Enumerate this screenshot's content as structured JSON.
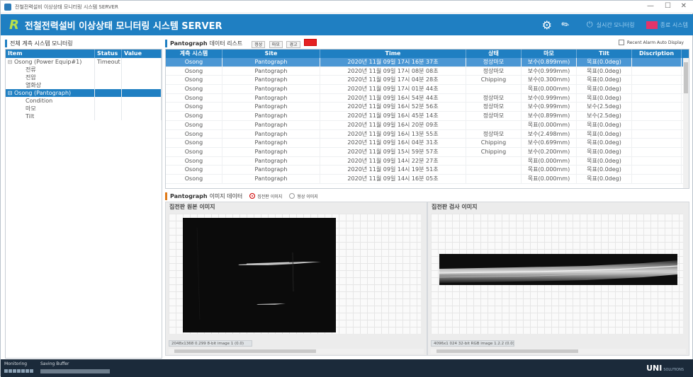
{
  "window": {
    "title": "전철전력설비 이상상태 모니터링 시스템 SERVER",
    "min": "—",
    "max": "☐",
    "close": "✕"
  },
  "header": {
    "title": "전철전력설비 이상상태 모니터링 시스템 SERVER",
    "realtime_label": "실시간 모니터링",
    "exit_label": "종료 시스템",
    "accent": "#1f7fc2"
  },
  "left": {
    "section_title": "전체 계측 시스템 모니터링",
    "columns": [
      "Item",
      "Status",
      "Value"
    ],
    "rows": [
      {
        "label": "Osong (Power Equip#1)",
        "status": "Timeout",
        "level": 0,
        "expander": "⊟",
        "selected": false
      },
      {
        "label": "전류",
        "status": "",
        "level": 1,
        "selected": false
      },
      {
        "label": "전압",
        "status": "",
        "level": 1,
        "selected": false
      },
      {
        "label": "열화상",
        "status": "",
        "level": 1,
        "selected": false
      },
      {
        "label": "Osong (Pantograph)",
        "status": "",
        "level": 0,
        "expander": "⊟",
        "selected": true
      },
      {
        "label": "Condition",
        "status": "",
        "level": 1,
        "selected": false
      },
      {
        "label": "마모",
        "status": "",
        "level": 1,
        "selected": false
      },
      {
        "label": "Tilt",
        "status": "",
        "level": 1,
        "selected": false
      }
    ]
  },
  "data_list": {
    "title_en": "Pantograph",
    "title_ko": "데이터 리스트",
    "filters": [
      "정상",
      "마모",
      "경고",
      ""
    ],
    "checkbox_label": "Recent Alarm Auto Display",
    "columns": [
      "계측 시스템",
      "Site",
      "Time",
      "상태",
      "마모",
      "Tilt",
      "Discription"
    ],
    "rows": [
      [
        "Osong",
        "Pantograph",
        "2020년 11월 09일 17시 16분 37초",
        "정상마모",
        "보수(0.899mm)",
        "목표(0.0deg)",
        ""
      ],
      [
        "Osong",
        "Pantograph",
        "2020년 11월 09일 17시 08분 08초",
        "정상마모",
        "보수(0.999mm)",
        "목표(0.0deg)",
        ""
      ],
      [
        "Osong",
        "Pantograph",
        "2020년 11월 09일 17시 04분 28초",
        "Chipping",
        "보수(0.300mm)",
        "목표(0.0deg)",
        ""
      ],
      [
        "Osong",
        "Pantograph",
        "2020년 11월 09일 17시 01분 44초",
        "",
        "목표(0.000mm)",
        "목표(0.0deg)",
        ""
      ],
      [
        "Osong",
        "Pantograph",
        "2020년 11월 09일 16시 54분 44초",
        "정상마모",
        "보수(0.999mm)",
        "목표(0.0deg)",
        ""
      ],
      [
        "Osong",
        "Pantograph",
        "2020년 11월 09일 16시 52분 56초",
        "정상마모",
        "보수(0.999mm)",
        "보수(2.5deg)",
        ""
      ],
      [
        "Osong",
        "Pantograph",
        "2020년 11월 09일 16시 45분 14초",
        "정상마모",
        "보수(0.899mm)",
        "보수(2.5deg)",
        ""
      ],
      [
        "Osong",
        "Pantograph",
        "2020년 11월 09일 16시 20분 09초",
        "",
        "목표(0.000mm)",
        "목표(0.0deg)",
        ""
      ],
      [
        "Osong",
        "Pantograph",
        "2020년 11월 09일 16시 13분 55초",
        "정상마모",
        "보수(2.498mm)",
        "목표(0.0deg)",
        ""
      ],
      [
        "Osong",
        "Pantograph",
        "2020년 11월 09일 16시 04분 31초",
        "Chipping",
        "보수(0.699mm)",
        "목표(0.0deg)",
        ""
      ],
      [
        "Osong",
        "Pantograph",
        "2020년 11월 09일 15시 59분 57초",
        "Chipping",
        "보수(0.200mm)",
        "목표(0.0deg)",
        ""
      ],
      [
        "Osong",
        "Pantograph",
        "2020년 11월 09일 14시 22분 27초",
        "",
        "목표(0.000mm)",
        "목표(0.0deg)",
        ""
      ],
      [
        "Osong",
        "Pantograph",
        "2020년 11월 09일 14시 19분 51초",
        "",
        "목표(0.000mm)",
        "목표(0.0deg)",
        ""
      ],
      [
        "Osong",
        "Pantograph",
        "2020년 11월 09일 14시 16분 05초",
        "",
        "목표(0.000mm)",
        "목표(0.0deg)",
        ""
      ]
    ]
  },
  "image_data": {
    "title_en": "Pantograph",
    "title_ko": "이미지 데이터",
    "radio_options": [
      "집전판 이미지",
      "형상 이미지"
    ],
    "selected_option": "집전판 이미지",
    "left_caption": "집전판 원본 이미지",
    "right_caption": "집전판 검사 이미지",
    "left_status": "2048x1368 0.299 8-bit image 1     (0.0)",
    "right_status": "4096x1 024 32-bit RGB image 1.2.2     (0.0)"
  },
  "statusbar": {
    "monitoring_label": "Monitoring",
    "buffer_label": "Saving Buffer",
    "brand": "UNI",
    "brand_sub": "SOLUTIONS"
  }
}
